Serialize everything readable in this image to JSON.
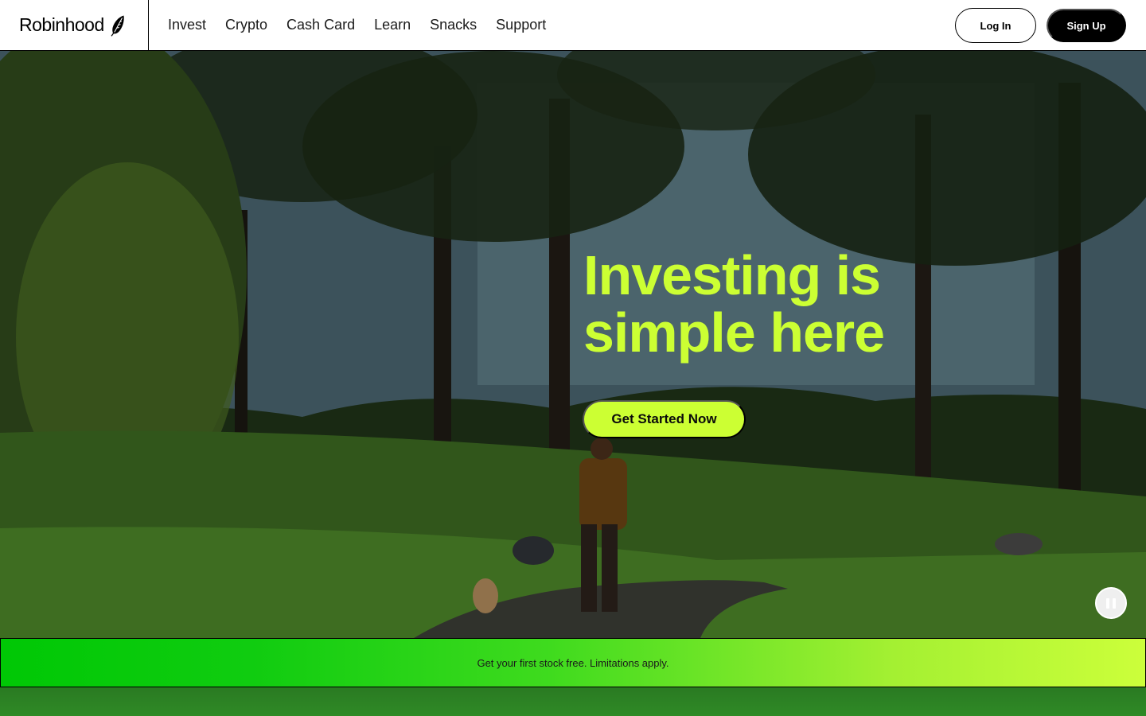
{
  "brand": {
    "name": "Robinhood",
    "icon": "feather-icon",
    "accent_color": "#ccff33"
  },
  "nav": {
    "items": [
      {
        "label": "Invest"
      },
      {
        "label": "Crypto"
      },
      {
        "label": "Cash Card"
      },
      {
        "label": "Learn"
      },
      {
        "label": "Snacks"
      },
      {
        "label": "Support"
      }
    ]
  },
  "auth": {
    "login_label": "Log In",
    "signup_label": "Sign Up"
  },
  "hero": {
    "headline_line1": "Investing is",
    "headline_line2": "simple here",
    "cta_label": "Get Started Now",
    "pause_icon": "pause-icon",
    "headline_color": "#ccff33"
  },
  "promo": {
    "text": "Get your first stock free. Limitations apply.",
    "gradient_start": "#00c805",
    "gradient_end": "#ccff3a"
  }
}
